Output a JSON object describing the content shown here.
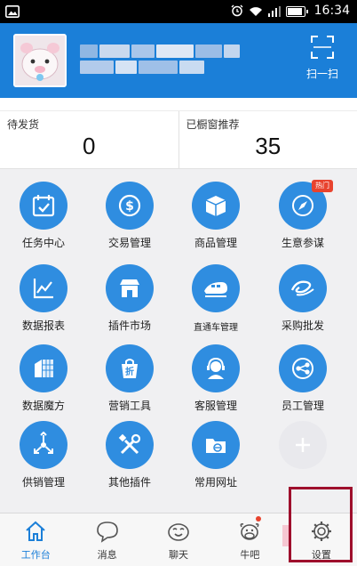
{
  "status_bar": {
    "time": "16:34"
  },
  "header": {
    "scan_label": "扫一扫"
  },
  "stats": [
    {
      "label": "待发货",
      "value": "0"
    },
    {
      "label": "已橱窗推荐",
      "value": "35"
    }
  ],
  "grid": {
    "hot_badge": "热门",
    "items": [
      {
        "label": "任务中心",
        "icon": "task-center-icon"
      },
      {
        "label": "交易管理",
        "icon": "trade-icon"
      },
      {
        "label": "商品管理",
        "icon": "goods-icon"
      },
      {
        "label": "生意参谋",
        "icon": "compass-icon"
      },
      {
        "label": "数据报表",
        "icon": "chart-icon"
      },
      {
        "label": "插件市场",
        "icon": "store-icon"
      },
      {
        "label": "直通车管理",
        "icon": "train-icon"
      },
      {
        "label": "采购批发",
        "icon": "alibaba-icon"
      },
      {
        "label": "数据魔方",
        "icon": "data-cube-icon"
      },
      {
        "label": "营销工具",
        "icon": "discount-bag-icon"
      },
      {
        "label": "客服管理",
        "icon": "headset-icon"
      },
      {
        "label": "员工管理",
        "icon": "staff-icon"
      },
      {
        "label": "供销管理",
        "icon": "distribution-icon"
      },
      {
        "label": "其他插件",
        "icon": "tools-icon"
      },
      {
        "label": "常用网址",
        "icon": "folder-icon"
      }
    ]
  },
  "bottom_nav": [
    {
      "label": "工作台",
      "icon": "home-icon"
    },
    {
      "label": "消息",
      "icon": "message-icon"
    },
    {
      "label": "聊天",
      "icon": "chat-icon"
    },
    {
      "label": "牛吧",
      "icon": "cow-icon"
    },
    {
      "label": "设置",
      "icon": "gear-icon"
    }
  ],
  "colors": {
    "brand": "#1b7fd8",
    "accent": "#2f8de0",
    "badge": "#e8432e",
    "highlight": "#9e0f2c"
  }
}
